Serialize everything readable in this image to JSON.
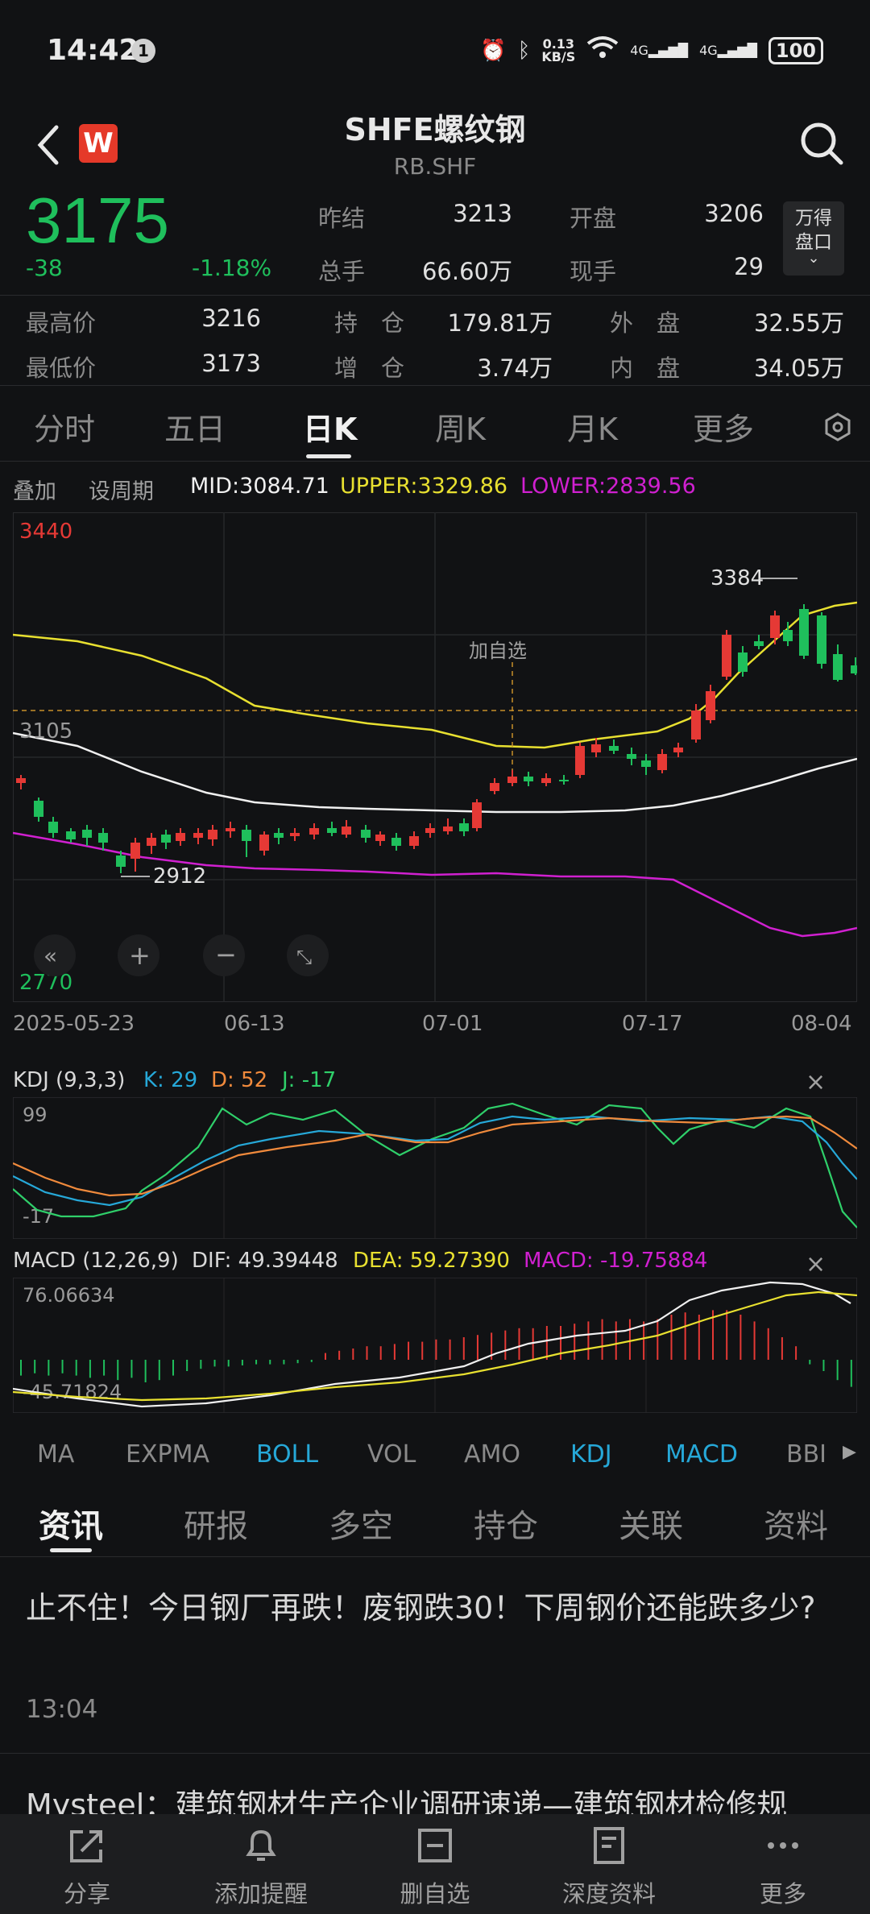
{
  "status": {
    "time": "14:42",
    "notif": "1",
    "speed_top": "0.13",
    "speed_bottom": "KB/S",
    "net1": "4G",
    "net2": "4G",
    "battery": "100"
  },
  "header": {
    "title": "SHFE螺纹钢",
    "code": "RB.SHF"
  },
  "quote": {
    "price": "3175",
    "change": "-38",
    "change_pct": "-1.18%",
    "fields": [
      {
        "label": "昨结",
        "value": "3213"
      },
      {
        "label": "开盘",
        "value": "3206"
      },
      {
        "label": "总手",
        "value": "66.60万"
      },
      {
        "label": "现手",
        "value": "29"
      }
    ],
    "wdpk": "万得盘口",
    "rows": [
      {
        "label": "最高价",
        "value": "3216"
      },
      {
        "label": "持　仓",
        "value": "179.81万"
      },
      {
        "label": "外　盘",
        "value": "32.55万"
      },
      {
        "label": "最低价",
        "value": "3173"
      },
      {
        "label": "增　仓",
        "value": "3.74万"
      },
      {
        "label": "内　盘",
        "value": "34.05万"
      }
    ]
  },
  "tabs": [
    "分时",
    "五日",
    "日K",
    "周K",
    "月K",
    "更多"
  ],
  "boll": {
    "overlay": "叠加",
    "period": "设周期",
    "mid": "MID:3084.71",
    "upper": "UPPER:3329.86",
    "lower": "LOWER:2839.56"
  },
  "chart_labels": {
    "top": "3440",
    "mid": "3105",
    "bottom": "2770",
    "high": "3384",
    "low": "2912",
    "add": "加自选"
  },
  "dates": [
    "2025-05-23",
    "06-13",
    "07-01",
    "07-17",
    "08-04"
  ],
  "kdj": {
    "name": "KDJ (9,3,3)",
    "k": "K: 29",
    "d": "D: 52",
    "j": "J: -17",
    "top": "99",
    "bottom": "-17"
  },
  "macd": {
    "name": "MACD (12,26,9)",
    "dif": "DIF: 49.39448",
    "dea": "DEA: 59.27390",
    "macd": "MACD: -19.75884",
    "top": "76.06634",
    "bottom": "-45.71824"
  },
  "indicator_tabs": [
    "MA",
    "EXPMA",
    "BOLL",
    "VOL",
    "AMO",
    "KDJ",
    "MACD",
    "BBI"
  ],
  "news_tabs": [
    "资讯",
    "研报",
    "多空",
    "持仓",
    "关联",
    "资料"
  ],
  "news": [
    {
      "title": "止不住！今日钢厂再跌！废钢跌30！下周钢价还能跌多少?",
      "time": "13:04"
    },
    {
      "title": "Mysteel：建筑钢材生产企业调研速递—建筑钢材检修规"
    }
  ],
  "bottom_nav": [
    "分享",
    "添加提醒",
    "删自选",
    "深度资料",
    "更多"
  ],
  "chart_data": {
    "type": "candlestick",
    "x": [
      "2025-05-23",
      "06-13",
      "07-01",
      "07-17",
      "08-04"
    ],
    "ylim": [
      2770,
      3440
    ],
    "high_label": 3384,
    "low_label": 2912,
    "last_close": 3175,
    "colors": {
      "up": "#e53935",
      "down": "#1fbf5c",
      "mid": "#ffffff",
      "upper": "#e8e030",
      "lower": "#d020d0"
    }
  }
}
